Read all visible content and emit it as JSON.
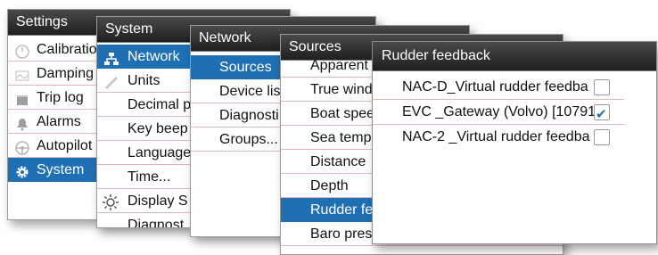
{
  "settings": {
    "title": "Settings",
    "items": [
      {
        "label": "Calibratio",
        "icon": "gauge-icon",
        "selected": false
      },
      {
        "label": "Damping",
        "icon": "damping-icon",
        "selected": false
      },
      {
        "label": "Trip log",
        "icon": "trip-log-icon",
        "selected": false
      },
      {
        "label": "Alarms",
        "icon": "bell-icon",
        "selected": false
      },
      {
        "label": "Autopilot",
        "icon": "steering-wheel-icon",
        "selected": false
      },
      {
        "label": "System",
        "icon": "gear-icon",
        "selected": true
      }
    ]
  },
  "system": {
    "title": "System",
    "items": [
      {
        "label": "Network",
        "icon": "network-icon",
        "selected": true
      },
      {
        "label": "Units",
        "icon": "ruler-icon",
        "selected": false
      },
      {
        "label": "Decimal p",
        "selected": false
      },
      {
        "label": "Key beep",
        "selected": false
      },
      {
        "label": "Language",
        "selected": false
      },
      {
        "label": "Time...",
        "selected": false
      },
      {
        "label": "Display S",
        "icon": "brightness-icon",
        "selected": false
      },
      {
        "label": "Diagnost",
        "selected": false
      }
    ]
  },
  "network": {
    "title": "Network",
    "items": [
      {
        "label": "Sources",
        "selected": true
      },
      {
        "label": "Device lis",
        "selected": false
      },
      {
        "label": "Diagnosti",
        "selected": false
      },
      {
        "label": "Groups...",
        "selected": false
      }
    ]
  },
  "sources": {
    "title": "Sources",
    "items": [
      {
        "label": "Apparent",
        "selected": false
      },
      {
        "label": "True wind",
        "selected": false
      },
      {
        "label": "Boat spee",
        "selected": false
      },
      {
        "label": "Sea temp",
        "selected": false
      },
      {
        "label": "Distance",
        "selected": false
      },
      {
        "label": "Depth",
        "selected": false
      },
      {
        "label": "Rudder fe",
        "selected": true
      },
      {
        "label": "Baro pres",
        "selected": false
      }
    ]
  },
  "rudder": {
    "title": "Rudder feedback",
    "items": [
      {
        "label": "NAC-D_Virtual rudder feedba",
        "checked": false
      },
      {
        "label": "EVC _Gateway (Volvo) [10791",
        "checked": true
      },
      {
        "label": "NAC-2 _Virtual rudder feedba",
        "checked": false
      }
    ]
  },
  "colors": {
    "selected": "#1f6fb5",
    "header": "#2a2a2a",
    "divider": "#e6b7b7"
  }
}
